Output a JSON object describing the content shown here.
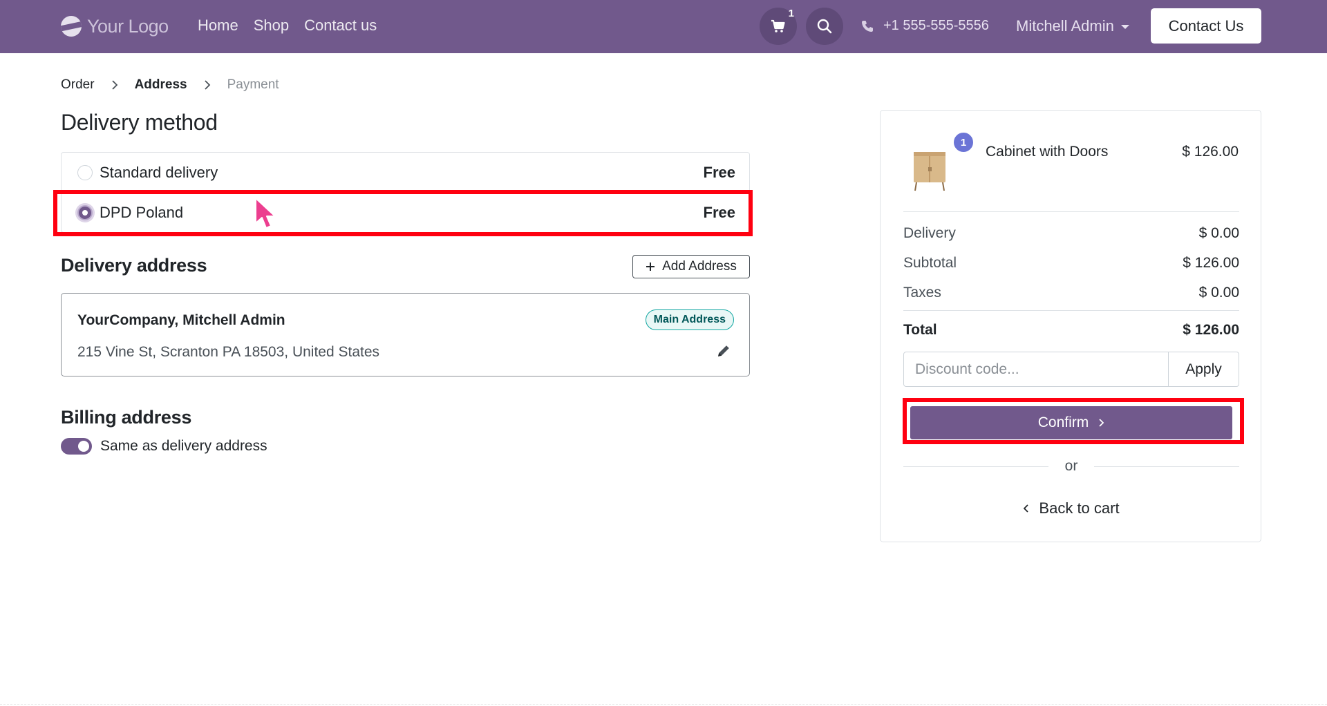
{
  "navbar": {
    "logo_text": "Your Logo",
    "links": [
      "Home",
      "Shop",
      "Contact us"
    ],
    "cart_count": "1",
    "phone": "+1 555-555-5556",
    "user": "Mitchell Admin",
    "contact_button": "Contact Us"
  },
  "breadcrumb": {
    "steps": [
      "Order",
      "Address",
      "Payment"
    ],
    "active": "Address"
  },
  "delivery": {
    "title": "Delivery method",
    "options": [
      {
        "label": "Standard delivery",
        "price": "Free",
        "selected": false
      },
      {
        "label": "DPD Poland",
        "price": "Free",
        "selected": true
      }
    ]
  },
  "delivery_address": {
    "title": "Delivery address",
    "add_button": "Add Address",
    "name": "YourCompany, Mitchell Admin",
    "line": "215 Vine St, Scranton PA 18503, United States",
    "badge": "Main Address"
  },
  "billing": {
    "title": "Billing address",
    "toggle_label": "Same as delivery address",
    "toggle_on": true
  },
  "summary": {
    "product": {
      "name": "Cabinet with Doors",
      "price": "$ 126.00",
      "quantity": "1"
    },
    "rows": [
      {
        "label": "Delivery",
        "value": "$ 0.00"
      },
      {
        "label": "Subtotal",
        "value": "$ 126.00"
      },
      {
        "label": "Taxes",
        "value": "$ 0.00"
      }
    ],
    "total": {
      "label": "Total",
      "value": "$ 126.00"
    },
    "discount_placeholder": "Discount code...",
    "apply_label": "Apply",
    "confirm_label": "Confirm",
    "or_label": "or",
    "back_label": "Back to cart"
  },
  "colors": {
    "brand": "#71598c",
    "highlight": "#ff0010",
    "badge_teal": "#0ea5a0",
    "qty_badge": "#6b74d6"
  }
}
